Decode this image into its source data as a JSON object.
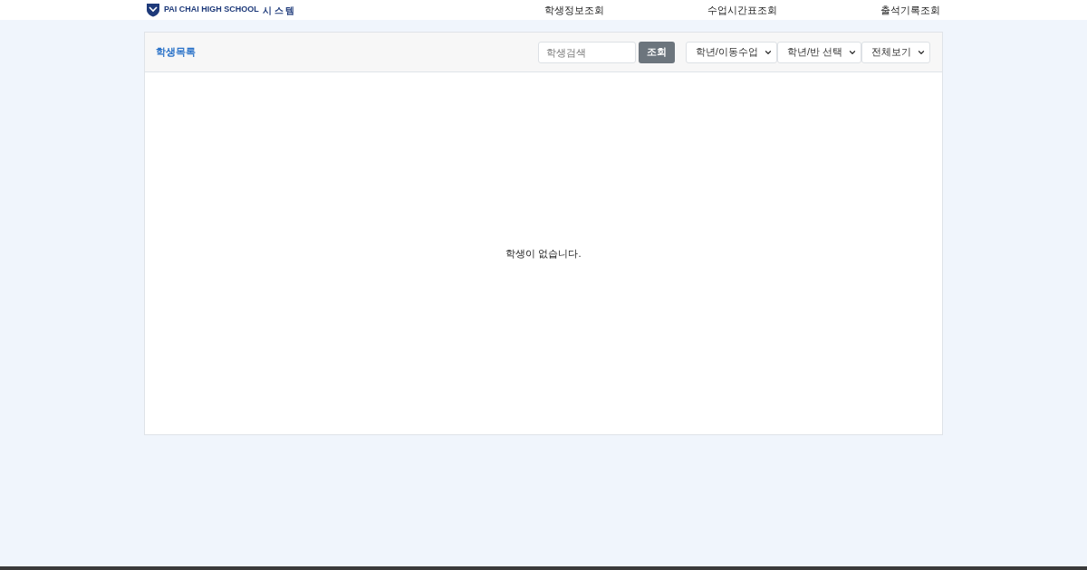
{
  "header": {
    "logo": {
      "school_en": "PAI CHAI HIGH SCHOOL",
      "system": "시 스 템"
    },
    "nav": [
      {
        "label": "학생정보조회"
      },
      {
        "label": "수업시간표조회"
      },
      {
        "label": "출석기록조회"
      }
    ]
  },
  "panel": {
    "title": "학생목록",
    "search": {
      "placeholder": "학생검색"
    },
    "search_button": "조회",
    "selects": [
      {
        "value": "학년/이동수업"
      },
      {
        "value": "학년/반 선택"
      },
      {
        "value": "전체보기"
      }
    ],
    "empty_message": "학생이 없습니다."
  }
}
